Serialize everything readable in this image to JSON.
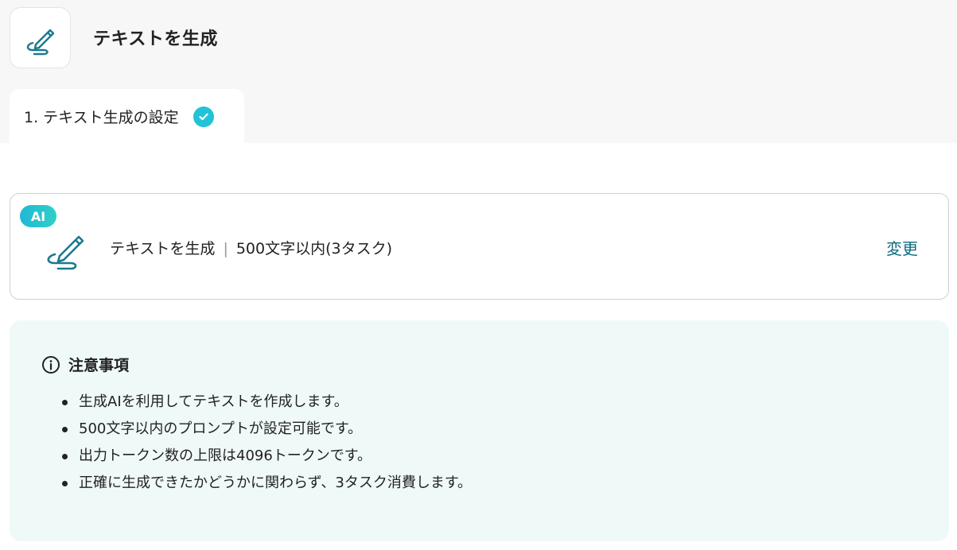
{
  "header": {
    "app_icon": "pen-scribble-icon",
    "title": "テキストを生成"
  },
  "step_tab": {
    "label": "1. テキスト生成の設定",
    "status_icon": "check-circle-icon",
    "status_color": "#22c3d8"
  },
  "action_card": {
    "badge": "AI",
    "icon": "pen-scribble-icon",
    "action_name": "テキストを生成",
    "separator": "|",
    "detail": "500文字以内(3タスク)",
    "change_label": "変更"
  },
  "notice": {
    "icon": "info-circle-icon",
    "title": "注意事項",
    "items": [
      "生成AIを利用してテキストを作成します。",
      "500文字以内のプロンプトが設定可能です。",
      "出力トークン数の上限は4096トークンです。",
      "正確に生成できたかどうかに関わらず、3タスク消費します。"
    ]
  },
  "colors": {
    "accent": "#0b6b80",
    "badge_gradient_start": "#20b8d6",
    "badge_gradient_end": "#2fd0c7",
    "notice_bg": "#eff9f8"
  }
}
